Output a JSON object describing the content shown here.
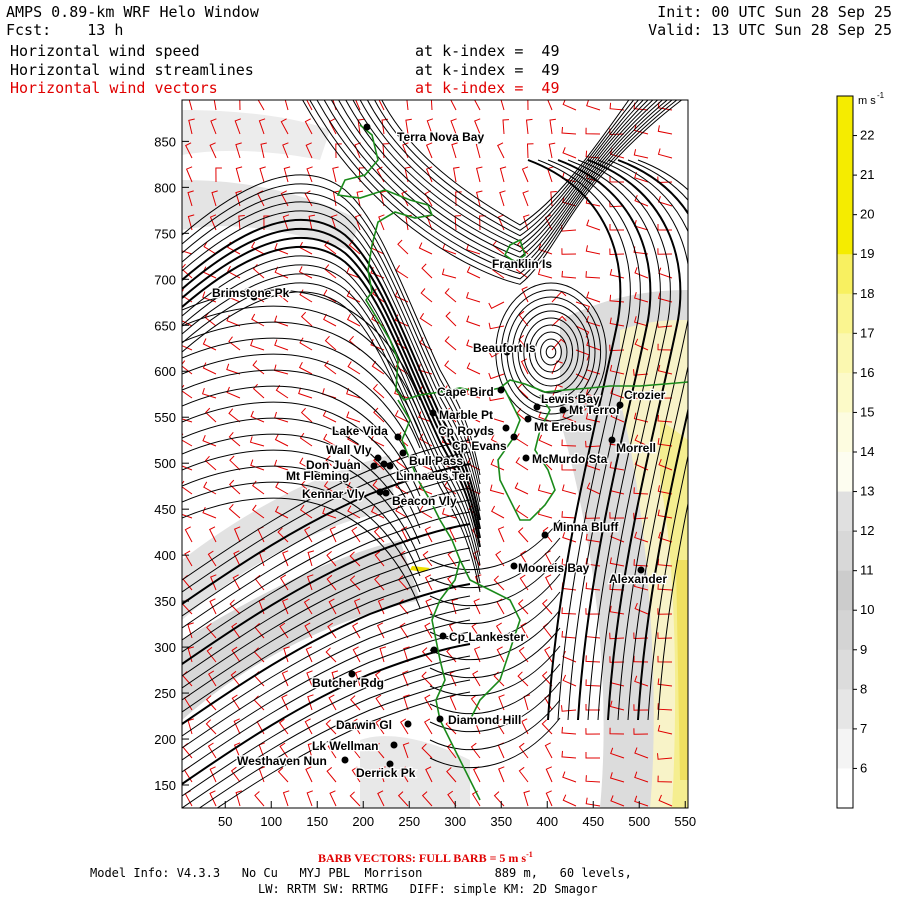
{
  "header": {
    "title": "AMPS 0.89-km WRF Helo Window",
    "init": "Init: 00 UTC Sun 28 Sep 25",
    "fcst_label": "Fcst:",
    "fcst_value": "13 h",
    "valid": "Valid: 13 UTC Sun 28 Sep 25",
    "fields": [
      {
        "name": "Horizontal wind speed",
        "level": "at k-index =  49",
        "color": "#000000"
      },
      {
        "name": "Horizontal wind streamlines",
        "level": "at k-index =  49",
        "color": "#000000"
      },
      {
        "name": "Horizontal wind vectors",
        "level": "at k-index =  49",
        "color": "#e00000"
      }
    ]
  },
  "map": {
    "x_ticks": [
      "50",
      "100",
      "150",
      "200",
      "250",
      "300",
      "350",
      "400",
      "450",
      "500",
      "550"
    ],
    "y_ticks": [
      "850",
      "800",
      "750",
      "700",
      "650",
      "600",
      "550",
      "500",
      "450",
      "400",
      "350",
      "300",
      "250",
      "200",
      "150"
    ],
    "colors": {
      "coastline": "#1a8a1a",
      "barbs": "#e00000",
      "streamlines": "#000000"
    },
    "places": [
      {
        "name": "Terra Nova Bay"
      },
      {
        "name": "Franklin Is"
      },
      {
        "name": "Brimstone Pk"
      },
      {
        "name": "Beaufort Is"
      },
      {
        "name": "Cape Bird"
      },
      {
        "name": "Marble Pt"
      },
      {
        "name": "Lewis Bay"
      },
      {
        "name": "Mt Terror"
      },
      {
        "name": "Lake Vida"
      },
      {
        "name": "Cp Royds"
      },
      {
        "name": "Mt Erebus"
      },
      {
        "name": "Cp Evans"
      },
      {
        "name": "Wall Vly"
      },
      {
        "name": "Don Juan"
      },
      {
        "name": "Bull Pass"
      },
      {
        "name": "McMurdo Sta"
      },
      {
        "name": "Mt Fleming"
      },
      {
        "name": "Linnaeus Ter"
      },
      {
        "name": "Kennar Vly"
      },
      {
        "name": "Beacon Vly"
      },
      {
        "name": "Minna Bluff"
      },
      {
        "name": "Mooreis Bay"
      },
      {
        "name": "Alexander"
      },
      {
        "name": "Cp Lankester"
      },
      {
        "name": "Butcher Rdg"
      },
      {
        "name": "Darwin Gl"
      },
      {
        "name": "Diamond Hill"
      },
      {
        "name": "Lk Wellman"
      },
      {
        "name": "Westhaven Nun"
      },
      {
        "name": "Derrick Pk"
      },
      {
        "name": "Crozier"
      },
      {
        "name": "Morrell"
      }
    ]
  },
  "colorbar": {
    "unit": "m s",
    "unit_sup": "-1",
    "labels": [
      "22",
      "21",
      "20",
      "19",
      "18",
      "17",
      "16",
      "15",
      "14",
      "13",
      "12",
      "11",
      "10",
      "9",
      "8",
      "7",
      "6"
    ],
    "colors": [
      "#f5ec00",
      "#f5ec00",
      "#f5ec00",
      "#f5ec00",
      "#f8f060",
      "#faf590",
      "#fbf8b0",
      "#fcfac8",
      "#fdfce0",
      "#fdfdf0",
      "#e0e0e0",
      "#d8d8d8",
      "#cccccc",
      "#d4d4d4",
      "#dcdcdc",
      "#e6e6e6",
      "#f4f4f4",
      "#ffffff"
    ]
  },
  "footer": {
    "barb_note": "BARB VECTORS: FULL BARB = 5 m s",
    "barb_sup": "-1",
    "model_info": "Model Info: V4.3.3   No Cu   MYJ PBL  Morrison          889 m,   60 levels,",
    "physics": "LW: RRTM SW: RRTMG   DIFF: simple KM: 2D Smagor"
  }
}
